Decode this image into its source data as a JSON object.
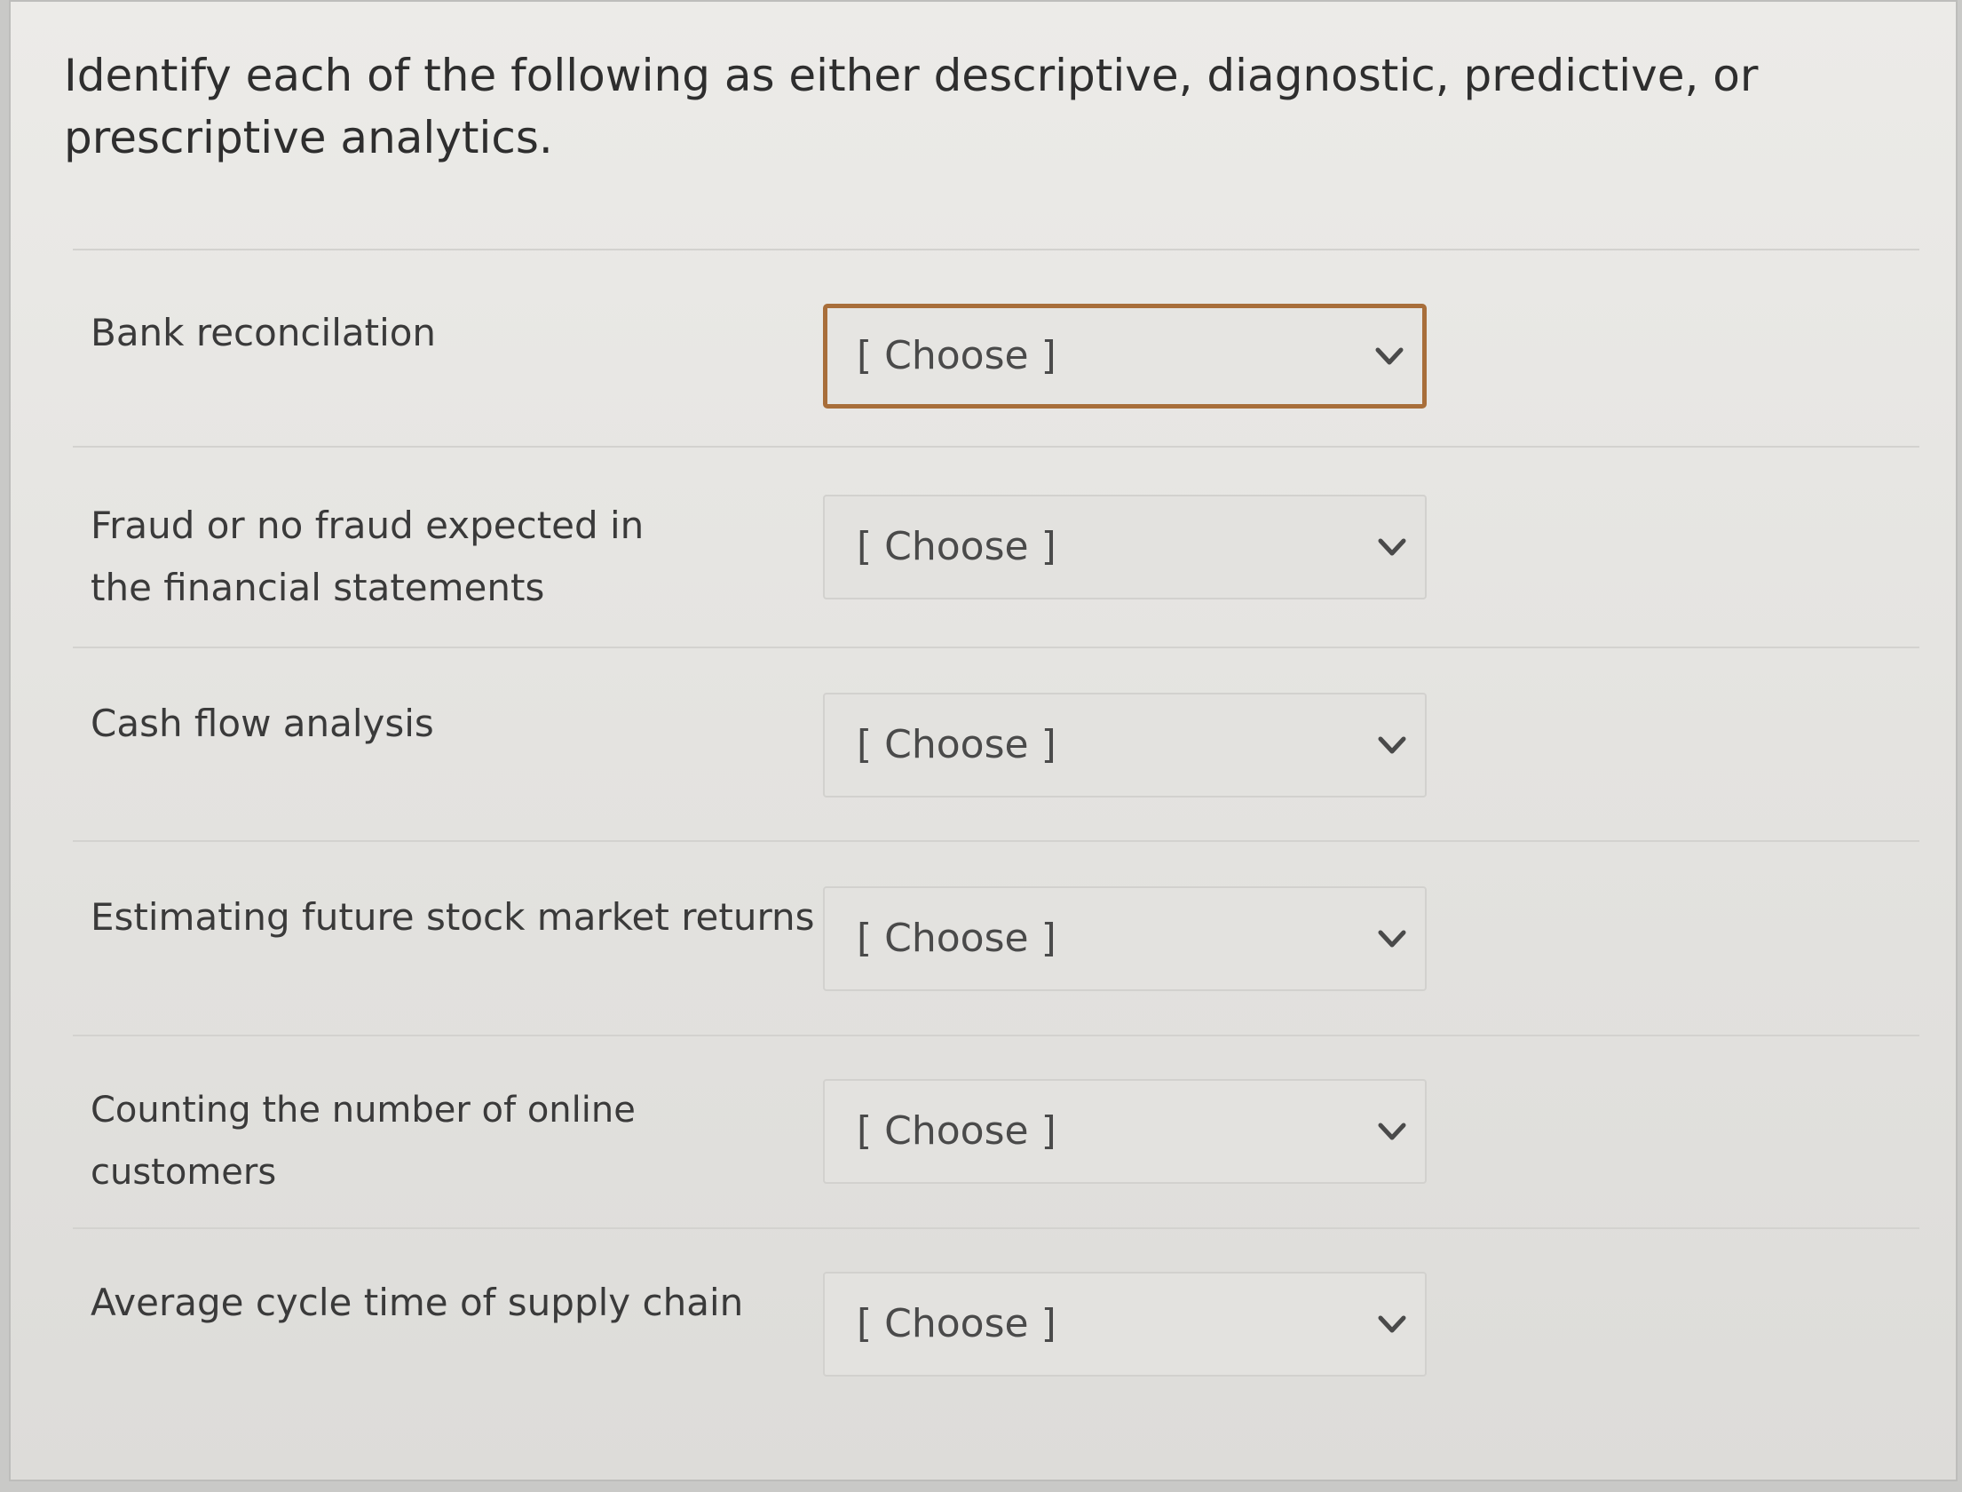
{
  "question": {
    "text": "Identify each of the following as either descriptive, diagnostic, predictive, or prescriptive analytics."
  },
  "rows": [
    {
      "label": "Bank reconcilation",
      "value": "[ Choose ]"
    },
    {
      "label": "Fraud or no fraud expected in the financial statements",
      "value": "[ Choose ]"
    },
    {
      "label": "Cash flow analysis",
      "value": "[ Choose ]"
    },
    {
      "label": "Estimating future stock market returns",
      "value": "[ Choose ]"
    },
    {
      "label": "Counting the number of online customers",
      "value": "[ Choose ]"
    },
    {
      "label": "Average cycle time of supply chain",
      "value": "[ Choose ]"
    }
  ],
  "icons": {
    "dropdown": "chevron-down-icon"
  },
  "colors": {
    "focus_border": "#a86e3a",
    "text": "#3a3a3a"
  }
}
